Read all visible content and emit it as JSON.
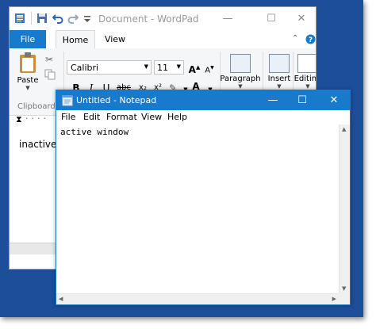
{
  "wordpad": {
    "title": "Document - WordPad",
    "tabs": {
      "file": "File",
      "home": "Home",
      "view": "View"
    },
    "clipboard": {
      "paste_label": "Paste",
      "group_label": "Clipboard"
    },
    "font": {
      "name": "Calibri",
      "size": "11"
    },
    "format_buttons": {
      "bold": "B",
      "italic": "I",
      "underline": "U",
      "strike": "abc",
      "subscript": "x₂",
      "superscript": "x²",
      "font_color": "A"
    },
    "groups": {
      "paragraph": "Paragraph",
      "insert": "Insert",
      "editing": "Editing"
    },
    "document_text": "inactive"
  },
  "notepad": {
    "title": "Untitled - Notepad",
    "menu": {
      "file": "File",
      "edit": "Edit",
      "format": "Format",
      "view": "View",
      "help": "Help"
    },
    "content": "active window"
  },
  "colors": {
    "desktop": "#1d4e9a",
    "accent": "#1979ca",
    "ribbon": "#f5f6f7"
  }
}
